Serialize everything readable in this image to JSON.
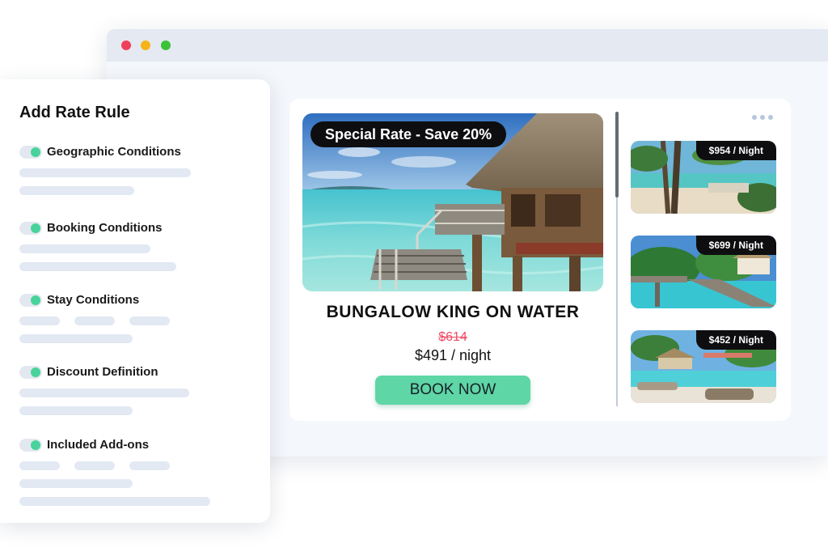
{
  "panel": {
    "title": "Add Rate Rule",
    "rules": [
      {
        "label": "Geographic Conditions",
        "enabled": true
      },
      {
        "label": "Booking Conditions",
        "enabled": true
      },
      {
        "label": "Stay Conditions",
        "enabled": true
      },
      {
        "label": "Discount Definition",
        "enabled": true
      },
      {
        "label": "Included Add-ons",
        "enabled": true
      }
    ]
  },
  "featured": {
    "promo": "Special Rate - Save 20%",
    "room_name": "BUNGALOW KING ON WATER",
    "original_price": "$614",
    "price": "$491 / night",
    "cta": "BOOK NOW"
  },
  "thumbnails": [
    {
      "price": "$954 / Night"
    },
    {
      "price": "$699 / Night"
    },
    {
      "price": "$452 / Night"
    }
  ],
  "colors": {
    "accent_green": "#5ed6a5",
    "toggle_knob": "#47d39b",
    "strike_red": "#f04a64",
    "dark_badge": "#0e0e10"
  },
  "icons": {
    "menu": "more-dots-icon"
  }
}
